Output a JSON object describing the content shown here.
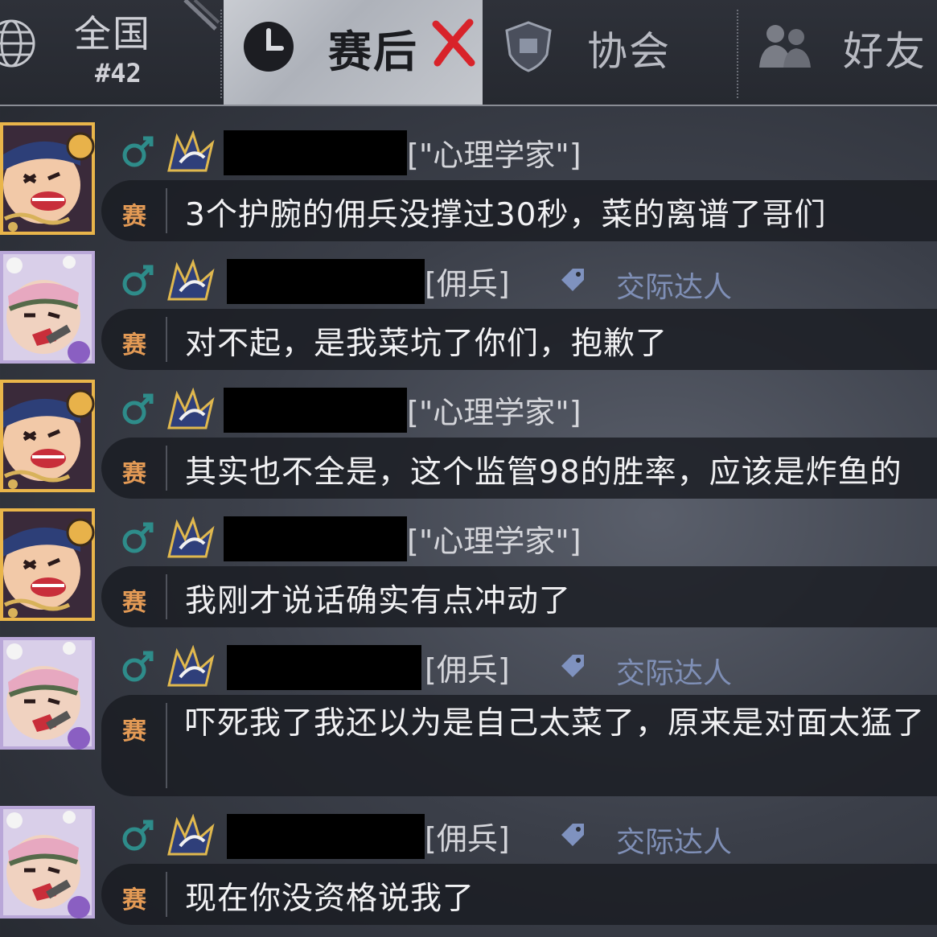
{
  "tabs": {
    "national": {
      "label": "全国",
      "rank": "#42"
    },
    "post_match": {
      "label": "赛后"
    },
    "association": {
      "label": "协会"
    },
    "friends": {
      "label": "好友"
    }
  },
  "colors": {
    "role_text": "#d4d5da",
    "title_text": "#7f8fb6",
    "match_tag": "#e39a55",
    "close_x": "#d8232a"
  },
  "messages": [
    {
      "avatar": "psychologist-avatar",
      "gender": "male-icon",
      "badge_rank": "III",
      "role": "[\"心理学家\"]",
      "title": "",
      "tag": "赛",
      "text": "3个护腕的佣兵没撑过30秒，菜的离谱了哥们"
    },
    {
      "avatar": "mercenary-avatar",
      "gender": "male-icon",
      "badge_rank": "IV",
      "role": "[佣兵]",
      "title": "交际达人",
      "tag": "赛",
      "text": "对不起，是我菜坑了你们，抱歉了"
    },
    {
      "avatar": "psychologist-avatar",
      "gender": "male-icon",
      "badge_rank": "III",
      "role": "[\"心理学家\"]",
      "title": "",
      "tag": "赛",
      "text": "其实也不全是，这个监管98的胜率，应该是炸鱼的"
    },
    {
      "avatar": "psychologist-avatar",
      "gender": "male-icon",
      "badge_rank": "III",
      "role": "[\"心理学家\"]",
      "title": "",
      "tag": "赛",
      "text": "我刚才说话确实有点冲动了"
    },
    {
      "avatar": "mercenary-avatar",
      "gender": "male-icon",
      "badge_rank": "IV",
      "role": "[佣兵]",
      "title": "交际达人",
      "tag": "赛",
      "text": "吓死我了我还以为是自己太菜了，原来是对面太猛了"
    },
    {
      "avatar": "mercenary-avatar",
      "gender": "male-icon",
      "badge_rank": "IV",
      "role": "[佣兵]",
      "title": "交际达人",
      "tag": "赛",
      "text": "现在你没资格说我了"
    }
  ]
}
